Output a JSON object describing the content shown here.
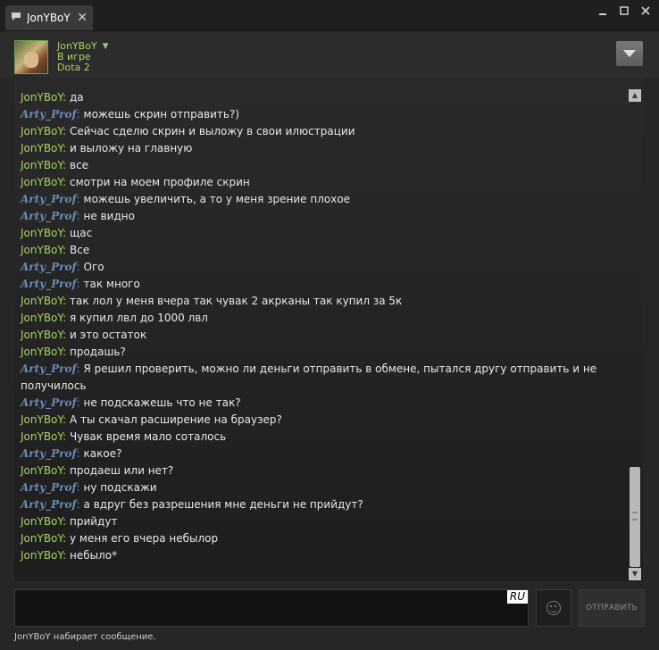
{
  "titlebar": {
    "tab_title": "JonYBoY",
    "tab_icon": "chat-bubble-icon",
    "controls": [
      "minimize-icon",
      "maximize-icon",
      "close-icon"
    ]
  },
  "header": {
    "name": "JonYBoY",
    "status": "В игре",
    "game": "Dota 2",
    "menu_icon": "chevron-down-icon"
  },
  "messages": [
    {
      "sender": "JonYBoY",
      "text": "да"
    },
    {
      "sender": "Arty_Prof",
      "text": "можешь скрин отправить?)"
    },
    {
      "sender": "JonYBoY",
      "text": "Сейчас сделю скрин и выложу в свои илюстрации"
    },
    {
      "sender": "JonYBoY",
      "text": "и выложу на главную"
    },
    {
      "sender": "JonYBoY",
      "text": "все"
    },
    {
      "sender": "JonYBoY",
      "text": "смотри на моем профиле скрин"
    },
    {
      "sender": "Arty_Prof",
      "text": "можешь увеличить, а то у меня зрение плохое"
    },
    {
      "sender": "Arty_Prof",
      "text": "не видно"
    },
    {
      "sender": "JonYBoY",
      "text": "щас"
    },
    {
      "sender": "JonYBoY",
      "text": "Все"
    },
    {
      "sender": "Arty_Prof",
      "text": "Ого"
    },
    {
      "sender": "Arty_Prof",
      "text": "так много"
    },
    {
      "sender": "JonYBoY",
      "text": "так лол у меня вчера так чувак 2 акрканы так купил за 5к"
    },
    {
      "sender": "JonYBoY",
      "text": "я купил лвл до 1000 лвл"
    },
    {
      "sender": "JonYBoY",
      "text": "и это остаток"
    },
    {
      "sender": "JonYBoY",
      "text": "продашь?"
    },
    {
      "sender": "Arty_Prof",
      "text": "Я решил проверить, можно ли деньги отправить в обмене, пытался другу отправить и не получилось"
    },
    {
      "sender": "Arty_Prof",
      "text": "не подскажешь что не так?"
    },
    {
      "sender": "JonYBoY",
      "text": "А ты скачал расширение на браузер?"
    },
    {
      "sender": "JonYBoY",
      "text": "Чувак время мало соталось"
    },
    {
      "sender": "Arty_Prof",
      "text": "какое?"
    },
    {
      "sender": "JonYBoY",
      "text": "продаеш или нет?"
    },
    {
      "sender": "Arty_Prof",
      "text": "ну подскажи"
    },
    {
      "sender": "Arty_Prof",
      "text": "а вдруг без разрешения мне деньги не прийдут?"
    },
    {
      "sender": "JonYBoY",
      "text": "прийдут"
    },
    {
      "sender": "JonYBoY",
      "text": "у меня его вчера небылор"
    },
    {
      "sender": "JonYBoY",
      "text": "небыло*"
    }
  ],
  "input": {
    "value": "",
    "language_badge": "RU",
    "emoji_icon": "smiley-icon",
    "send_label": "ОТПРАВИТЬ"
  },
  "status_bar": "JonYBoY набирает сообщение.",
  "colors": {
    "sender_jon": "#a8d25f",
    "sender_arty": "#6a8ab7",
    "background": "#262626"
  }
}
